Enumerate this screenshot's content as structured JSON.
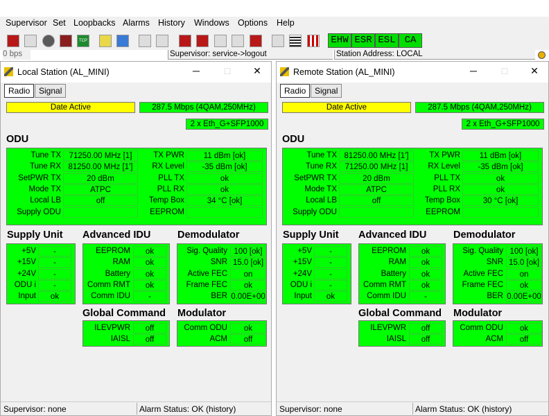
{
  "menu": [
    "Supervisor",
    "Set",
    "Loopbacks",
    "Alarms",
    "History",
    "Windows",
    "Options",
    "Help"
  ],
  "toolbar_icons": [
    "run-icon",
    "tools-icon",
    "stop-icon",
    "disk-icon",
    "tcp-icon",
    "hand-icon",
    "link-icon",
    "wrench-icon",
    "antenna-icon",
    "red-block-1-icon",
    "red-block-2-icon",
    "grey-block-1-icon",
    "grey-block-2-icon",
    "red-block-3-icon",
    "tune-icon",
    "grid-icon",
    "chart-icon"
  ],
  "toolbar_tcp": "TCP",
  "alarms": [
    "EHW",
    "ESR",
    "ESL",
    "CA"
  ],
  "strip": {
    "left": "0 bps",
    "mid": "Supervisor: service->logout",
    "right": "Station Address: LOCAL"
  },
  "colors": {
    "panel_green": "#00ff00",
    "date_yellow": "#ffff00"
  },
  "windows": [
    {
      "title": "Local Station (AL_MINI)",
      "tabs": [
        "Radio",
        "Signal"
      ],
      "date": "Date Active",
      "rate": "287.5 Mbps (4QAM,250MHz)",
      "eth": "2 x Eth_G+SFP1000",
      "odu_title": "ODU",
      "odu_left": [
        [
          "Tune TX",
          "71250.00 MHz [1]"
        ],
        [
          "Tune RX",
          "81250.00 MHz [1']"
        ],
        [
          "SetPWR TX",
          "20 dBm"
        ],
        [
          "Mode TX",
          "ATPC"
        ],
        [
          "Local LB",
          "off"
        ],
        [
          "Supply ODU",
          ""
        ]
      ],
      "odu_right": [
        [
          "TX PWR",
          "11 dBm [ok]"
        ],
        [
          "RX Level",
          "-35 dBm [ok]"
        ],
        [
          "PLL TX",
          "ok"
        ],
        [
          "PLL RX",
          "ok"
        ],
        [
          "Temp Box",
          "34 °C [ok]"
        ],
        [
          "EEPROM",
          ""
        ]
      ],
      "supply_title": "Supply Unit",
      "supply": [
        [
          "+5V",
          "-"
        ],
        [
          "+15V",
          "-"
        ],
        [
          "+24V",
          "-"
        ],
        [
          "ODU  i",
          "-"
        ],
        [
          "Input",
          "ok"
        ]
      ],
      "adv_title": "Advanced IDU",
      "adv": [
        [
          "EEPROM",
          "ok"
        ],
        [
          "RAM",
          "ok"
        ],
        [
          "Battery",
          "ok"
        ],
        [
          "Comm RMT",
          "ok"
        ],
        [
          "Comm IDU",
          "-"
        ]
      ],
      "demod_title": "Demodulator",
      "demod": [
        [
          "Sig. Quality",
          "100 [ok]"
        ],
        [
          "SNR",
          "15.0 [ok]"
        ],
        [
          "Active FEC",
          "on"
        ],
        [
          "Frame FEC",
          "ok"
        ],
        [
          "BER",
          "0.00E+00"
        ]
      ],
      "glob_title": "Global Command",
      "glob": [
        [
          "ILEVPWR",
          "off"
        ],
        [
          "IAISL",
          "off"
        ]
      ],
      "mod_title": "Modulator",
      "mod": [
        [
          "Comm ODU",
          "ok"
        ],
        [
          "ACM",
          "off"
        ]
      ],
      "status_sup": "Supervisor: none",
      "status_alarm": "Alarm Status: OK (history)"
    },
    {
      "title": "Remote Station (AL_MINI)",
      "tabs": [
        "Radio",
        "Signal"
      ],
      "date": "Date Active",
      "rate": "287.5 Mbps (4QAM,250MHz)",
      "eth": "2 x Eth_G+SFP1000",
      "odu_title": "ODU",
      "odu_left": [
        [
          "Tune TX",
          "81250.00 MHz [1']"
        ],
        [
          "Tune RX",
          "71250.00 MHz [1]"
        ],
        [
          "SetPWR TX",
          "20 dBm"
        ],
        [
          "Mode TX",
          "ATPC"
        ],
        [
          "Local LB",
          "off"
        ],
        [
          "Supply ODU",
          ""
        ]
      ],
      "odu_right": [
        [
          "TX PWR",
          "11 dBm [ok]"
        ],
        [
          "RX Level",
          "-35 dBm [ok]"
        ],
        [
          "PLL TX",
          "ok"
        ],
        [
          "PLL RX",
          "ok"
        ],
        [
          "Temp Box",
          "30 °C [ok]"
        ],
        [
          "EEPROM",
          ""
        ]
      ],
      "supply_title": "Supply Unit",
      "supply": [
        [
          "+5V",
          "-"
        ],
        [
          "+15V",
          "-"
        ],
        [
          "+24V",
          "-"
        ],
        [
          "ODU  i",
          "-"
        ],
        [
          "Input",
          "ok"
        ]
      ],
      "adv_title": "Advanced IDU",
      "adv": [
        [
          "EEPROM",
          "ok"
        ],
        [
          "RAM",
          "ok"
        ],
        [
          "Battery",
          "ok"
        ],
        [
          "Comm RMT",
          "ok"
        ],
        [
          "Comm IDU",
          "-"
        ]
      ],
      "demod_title": "Demodulator",
      "demod": [
        [
          "Sig. Quality",
          "100 [ok]"
        ],
        [
          "SNR",
          "15.0 [ok]"
        ],
        [
          "Active FEC",
          "on"
        ],
        [
          "Frame FEC",
          "ok"
        ],
        [
          "BER",
          "0.00E+00"
        ]
      ],
      "glob_title": "Global Command",
      "glob": [
        [
          "ILEVPWR",
          "off"
        ],
        [
          "IAISL",
          "off"
        ]
      ],
      "mod_title": "Modulator",
      "mod": [
        [
          "Comm ODU",
          "ok"
        ],
        [
          "ACM",
          "off"
        ]
      ],
      "status_sup": "Supervisor: none",
      "status_alarm": "Alarm Status: OK (history)"
    }
  ]
}
